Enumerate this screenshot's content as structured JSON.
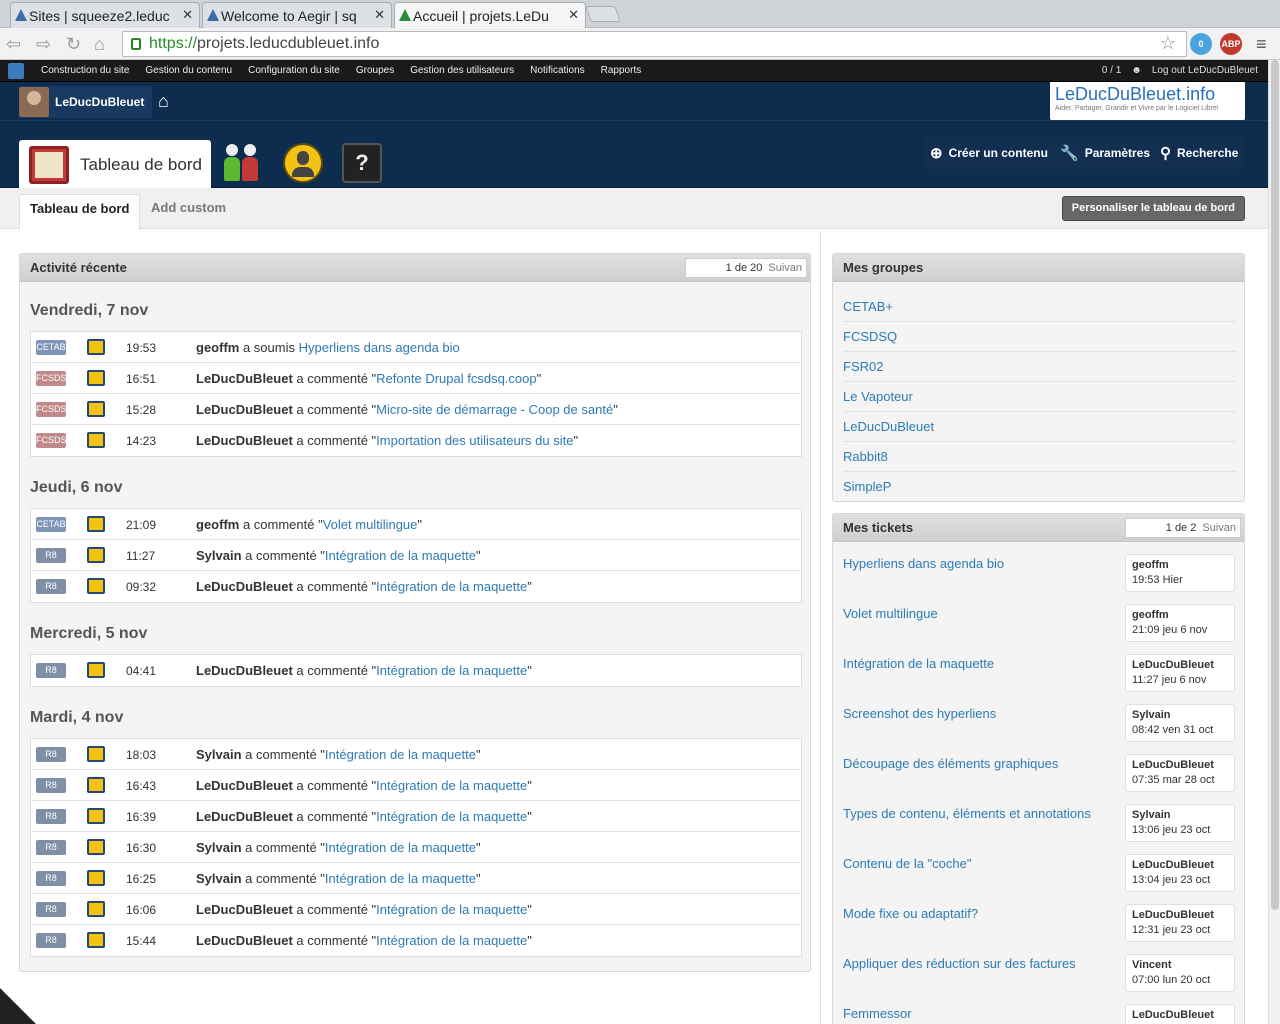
{
  "browser": {
    "tabs": [
      {
        "title": "Sites | squeeze2.leduc"
      },
      {
        "title": "Welcome to Aegir | sq"
      },
      {
        "title": "Accueil | projets.LeDu"
      }
    ],
    "url_scheme": "https://",
    "url_host": "projets.leducdubleuet.info",
    "ext_badge": "0",
    "abp": "ABP"
  },
  "adminbar": {
    "menu": [
      "Construction du site",
      "Gestion du contenu",
      "Configuration du site",
      "Groupes",
      "Gestion des utilisateurs",
      "Notifications",
      "Rapports"
    ],
    "counter": "0 / 1",
    "logout": "Log out LeDucDuBleuet"
  },
  "header": {
    "username": "LeDucDuBleuet",
    "logo_title": "LeDucDuBleuet.info",
    "logo_tagline": "Aider, Partager, Grandir et Vivre par le Logiciel Libre!",
    "dashboard_label": "Tableau de bord",
    "create": "Créer un contenu",
    "params": "Paramètres",
    "search": "Recherche",
    "help": "?"
  },
  "subtabs": {
    "active": "Tableau de bord",
    "other": "Add custom",
    "customize": "Personaliser le tableau de bord"
  },
  "activity": {
    "title": "Activité récente",
    "pager": "1 de 20",
    "next": "Suivan",
    "days": [
      {
        "label": "Vendredi, 7 nov",
        "rows": [
          {
            "badge": "CETAB",
            "time": "19:53",
            "user": "geoffm",
            "action": " a soumis ",
            "link": "Hyperliens dans agenda bio",
            "quote": false
          },
          {
            "badge": "FCSDS",
            "time": "16:51",
            "user": "LeDucDuBleuet",
            "action": " a commenté \"",
            "link": "Refonte Drupal fcsdsq.coop",
            "quote": true
          },
          {
            "badge": "FCSDS",
            "time": "15:28",
            "user": "LeDucDuBleuet",
            "action": " a commenté \"",
            "link": "Micro-site de démarrage - Coop de santé",
            "quote": true
          },
          {
            "badge": "FCSDS",
            "time": "14:23",
            "user": "LeDucDuBleuet",
            "action": " a commenté \"",
            "link": "Importation des utilisateurs du site",
            "quote": true
          }
        ]
      },
      {
        "label": "Jeudi, 6 nov",
        "rows": [
          {
            "badge": "CETAB",
            "time": "21:09",
            "user": "geoffm",
            "action": " a commenté \"",
            "link": "Volet multilingue",
            "quote": true
          },
          {
            "badge": "R8",
            "time": "11:27",
            "user": "Sylvain",
            "action": " a commenté \"",
            "link": "Intégration de la maquette",
            "quote": true
          },
          {
            "badge": "R8",
            "time": "09:32",
            "user": "LeDucDuBleuet",
            "action": " a commenté \"",
            "link": "Intégration de la maquette",
            "quote": true
          }
        ]
      },
      {
        "label": "Mercredi, 5 nov",
        "rows": [
          {
            "badge": "R8",
            "time": "04:41",
            "user": "LeDucDuBleuet",
            "action": " a commenté \"",
            "link": "Intégration de la maquette",
            "quote": true
          }
        ]
      },
      {
        "label": "Mardi, 4 nov",
        "rows": [
          {
            "badge": "R8",
            "time": "18:03",
            "user": "Sylvain",
            "action": " a commenté \"",
            "link": "Intégration de la maquette",
            "quote": true
          },
          {
            "badge": "R8",
            "time": "16:43",
            "user": "LeDucDuBleuet",
            "action": " a commenté \"",
            "link": "Intégration de la maquette",
            "quote": true
          },
          {
            "badge": "R8",
            "time": "16:39",
            "user": "LeDucDuBleuet",
            "action": " a commenté \"",
            "link": "Intégration de la maquette",
            "quote": true
          },
          {
            "badge": "R8",
            "time": "16:30",
            "user": "Sylvain",
            "action": " a commenté \"",
            "link": "Intégration de la maquette",
            "quote": true
          },
          {
            "badge": "R8",
            "time": "16:25",
            "user": "Sylvain",
            "action": " a commenté \"",
            "link": "Intégration de la maquette",
            "quote": true
          },
          {
            "badge": "R8",
            "time": "16:06",
            "user": "LeDucDuBleuet",
            "action": " a commenté \"",
            "link": "Intégration de la maquette",
            "quote": true
          },
          {
            "badge": "R8",
            "time": "15:44",
            "user": "LeDucDuBleuet",
            "action": " a commenté \"",
            "link": "Intégration de la maquette",
            "quote": true
          }
        ]
      }
    ]
  },
  "groups": {
    "title": "Mes groupes",
    "items": [
      "CETAB+",
      "FCSDSQ",
      "FSR02",
      "Le Vapoteur",
      "LeDucDuBleuet",
      "Rabbit8",
      "SimpleP"
    ]
  },
  "tickets": {
    "title": "Mes tickets",
    "pager": "1 de 2",
    "next": "Suivan",
    "items": [
      {
        "title": "Hyperliens dans agenda bio",
        "user": "geoffm",
        "when": "19:53 Hier"
      },
      {
        "title": "Volet multilingue",
        "user": "geoffm",
        "when": "21:09 jeu 6 nov"
      },
      {
        "title": "Intégration de la maquette",
        "user": "LeDucDuBleuet",
        "when": "11:27 jeu 6 nov"
      },
      {
        "title": "Screenshot des hyperliens",
        "user": "Sylvain",
        "when": "08:42 ven 31 oct"
      },
      {
        "title": "Découpage des éléments graphiques",
        "user": "LeDucDuBleuet",
        "when": "07:35 mar 28 oct"
      },
      {
        "title": "Types de contenu, éléments et annotations",
        "user": "Sylvain",
        "when": "13:06 jeu 23 oct"
      },
      {
        "title": "Contenu de la \"coche\"",
        "user": "LeDucDuBleuet",
        "when": "13:04 jeu 23 oct"
      },
      {
        "title": "Mode fixe ou adaptatif?",
        "user": "LeDucDuBleuet",
        "when": "12:31 jeu 23 oct"
      },
      {
        "title": "Appliquer des réduction sur des factures",
        "user": "Vincent",
        "when": "07:00 lun 20 oct"
      },
      {
        "title": "Femmessor",
        "user": "LeDucDuBleuet",
        "when": ""
      }
    ]
  },
  "colors": {
    "CETAB": "#7f95b8",
    "FCSDS": "#c08a8a",
    "R8": "#7f8fa6",
    "header_bg": "#0e2c4e",
    "link": "#2d7bb4"
  }
}
